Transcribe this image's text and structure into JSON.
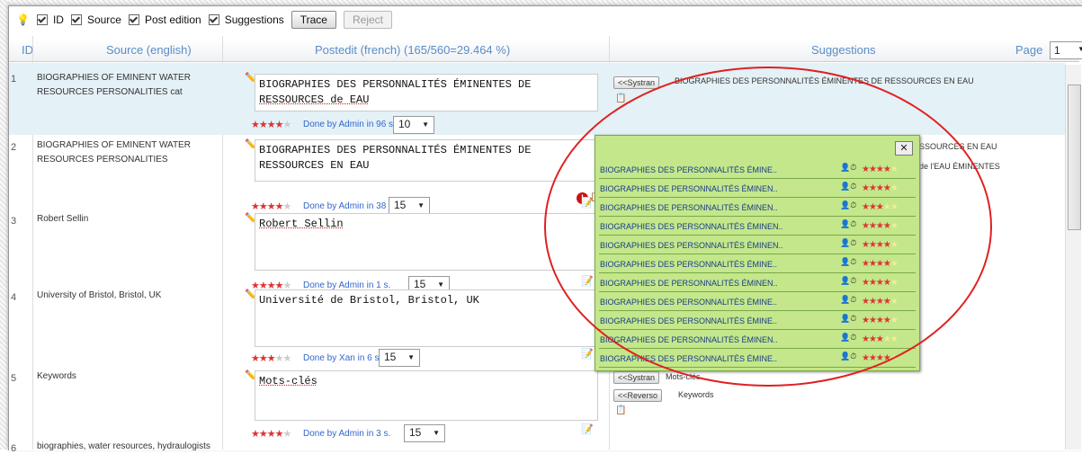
{
  "toolbar": {
    "bulb_icon": "lightbulb-icon",
    "checks": [
      {
        "label": "ID"
      },
      {
        "label": "Source"
      },
      {
        "label": "Post edition"
      },
      {
        "label": "Suggestions"
      }
    ],
    "trace_label": "Trace",
    "reject_label": "Reject"
  },
  "header": {
    "id": "ID",
    "source": "Source (english)",
    "postedit": "Postedit (french) (165/560=29.464 %)",
    "suggestions": "Suggestions",
    "page_label": "Page",
    "page_value": "1"
  },
  "rows": [
    {
      "id": "1",
      "source_l1": "BIOGRAPHIES OF EMINENT WATER",
      "source_l2": "RESOURCES PERSONALITIES cat",
      "post_l1": "BIOGRAPHIES DES PERSONNALITÉS ÉMINENTES DE",
      "post_l2": "RESSOURCES de EAU",
      "done": "Done by Admin in 96 s.",
      "score": "10",
      "stars": 4,
      "sug_btn": "<<Systran",
      "sug_text": "BIOGRAPHIES DES PERSONNALITÉS ÉMINENTES DE RESSOURCES EN EAU"
    },
    {
      "id": "2",
      "source_l1": "BIOGRAPHIES OF EMINENT WATER",
      "source_l2": "RESOURCES PERSONALITIES",
      "post_l1": "BIOGRAPHIES DES PERSONNALITÉS ÉMINENTES DE",
      "post_l2": "RESSOURCES EN EAU",
      "done": "Done by Admin in 38 s.",
      "score": "15",
      "stars": 4,
      "sug_text_a": "SSOURCES EN EAU",
      "sug_text_b": "de l'EAU ÉMINENTES"
    },
    {
      "id": "3",
      "source_l1": "Robert Sellin",
      "post_l1": "Robert Sellin",
      "done": "Done by Admin in 1 s.",
      "score": "15",
      "stars": 4
    },
    {
      "id": "4",
      "source_l1": "University of Bristol, Bristol, UK",
      "post_l1": "Université de Bristol, Bristol, UK",
      "done": "Done by Xan in 6 s.",
      "score": "15",
      "stars": 3
    },
    {
      "id": "5",
      "source_l1": "Keywords",
      "post_l1": "Mots-clés",
      "done": "Done by Admin in 3 s.",
      "score": "15",
      "stars": 4,
      "sug_btn_a": "<<Systran",
      "sug_text_a": "Mots-clés",
      "sug_btn_b": "<<Reverso",
      "sug_text_b": "Keywords"
    },
    {
      "id": "6",
      "source_l1": "biographies, water resources, hydraulogists"
    }
  ],
  "popup": {
    "close_label": "✕",
    "items": [
      {
        "text": "BIOGRAPHIES DES PERSONNALITÉS ÉMINE..",
        "stars": 4
      },
      {
        "text": "BIOGRAPHIES DE PERSONNALITÉS ÉMINEN..",
        "stars": 4
      },
      {
        "text": "BIOGRAPHIES DE PERSONNALITÉS ÉMINEN..",
        "stars": 3
      },
      {
        "text": "BIOGRAPHIES DES PERSONNALITÉS ÉMINEN..",
        "stars": 4
      },
      {
        "text": "BIOGRAPHIES DES PERSONNALITÉS ÉMINEN..",
        "stars": 4
      },
      {
        "text": "BIOGRAPHIES DES PERSONNALITÉS ÉMINE..",
        "stars": 4
      },
      {
        "text": "BIOGRAPHIES DE PERSONNALITÉS ÉMINEN..",
        "stars": 4
      },
      {
        "text": "BIOGRAPHIES DES PERSONNALITÉS ÉMINE..",
        "stars": 4
      },
      {
        "text": "BIOGRAPHIES DES PERSONNALITÉS ÉMINE..",
        "stars": 4
      },
      {
        "text": "BIOGRAPHIES DE PERSONNALITÉS ÉMINEN..",
        "stars": 3
      },
      {
        "text": "BIOGRAPHIES DES PERSONNALITÉS ÉMINE..",
        "stars": 4
      }
    ]
  },
  "colors": {
    "accent": "#5b8cc6",
    "popup_bg": "#c3e78a",
    "annotation": "#e02020",
    "star": "#dd3333"
  }
}
